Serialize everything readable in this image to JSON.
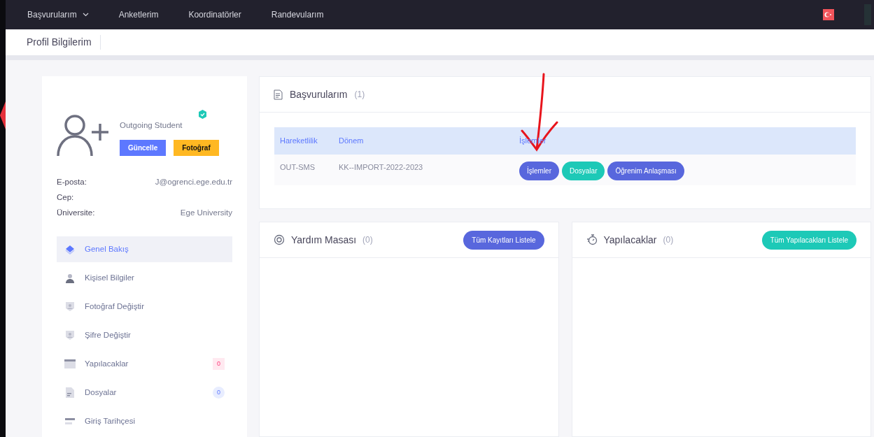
{
  "nav": {
    "items": [
      {
        "label": "Başvurularım",
        "dropdown": true
      },
      {
        "label": "Anketlerim",
        "dropdown": false
      },
      {
        "label": "Koordinatörler",
        "dropdown": false
      },
      {
        "label": "Randevularım",
        "dropdown": false
      }
    ]
  },
  "subheader": {
    "title": "Profil Bilgilerim"
  },
  "profile": {
    "role": "Outgoing Student",
    "verified": true,
    "buttons": [
      {
        "label": "Güncelle",
        "kind": "primary"
      },
      {
        "label": "Fotoğraf",
        "kind": "warning"
      }
    ],
    "fields": [
      {
        "label": "E-posta:",
        "value": "J@ogrenci.ege.edu.tr"
      },
      {
        "label": "Cep:"
      },
      {
        "label": "Üniversite:",
        "value": "Ege University"
      }
    ],
    "menu": [
      {
        "label": "Genel Bakış",
        "kind": "layers",
        "selected": true
      },
      {
        "label": "Kişisel Bilgiler",
        "kind": "person",
        "selected": false
      },
      {
        "label": "Fotoğraf Değiştir",
        "kind": "shield",
        "selected": false
      },
      {
        "label": "Şifre Değiştir",
        "kind": "shield",
        "selected": false
      },
      {
        "label": "Yapılacaklar",
        "kind": "card",
        "selected": false,
        "badge": "0"
      },
      {
        "label": "Dosyalar",
        "kind": "file",
        "selected": false,
        "badge": "0"
      },
      {
        "label": "Giriş Tarihçesi",
        "kind": "list",
        "selected": false
      }
    ]
  },
  "applications": {
    "title": "Başvurularım",
    "count": "(1)",
    "columns": [
      "Hareketlilik",
      "Dönem",
      "İşlemler"
    ],
    "rows": [
      {
        "cells": [
          "OUT-SMS",
          "KK--IMPORT-2022-2023"
        ],
        "actions": [
          {
            "label": "İşlemler",
            "color": "#5867dd"
          },
          {
            "label": "Dosyalar",
            "color": "#1dc9b7"
          },
          {
            "label": "Öğrenim Anlaşması",
            "color": "#5867dd"
          }
        ]
      }
    ]
  },
  "panels": [
    {
      "title": "Yardım Masası",
      "count": "(0)",
      "kind": "lifebuoy",
      "button": "Tüm Kayıtları Listele",
      "color": "#5867dd"
    },
    {
      "title": "Yapılacaklar",
      "count": "(0)",
      "kind": "stopwatch",
      "button": "Tüm Yapılacakları Listele",
      "color": "#1dc9b7"
    }
  ]
}
